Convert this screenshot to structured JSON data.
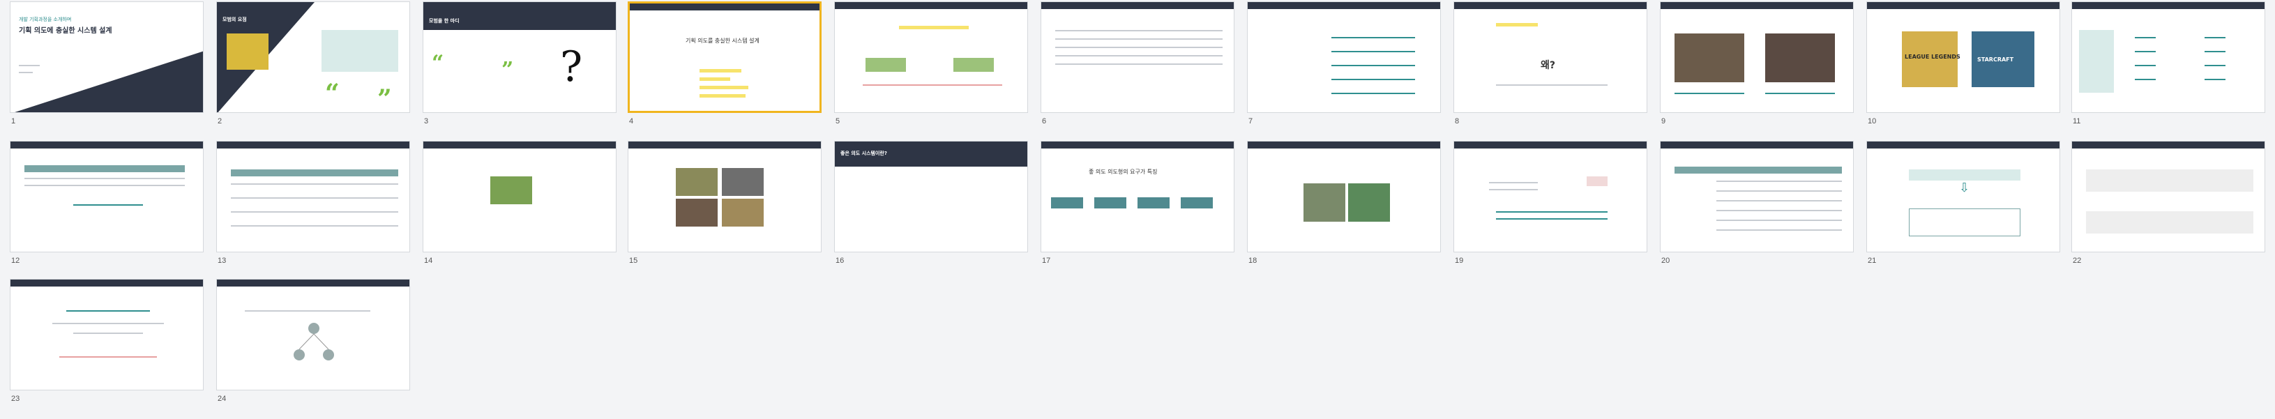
{
  "slides": [
    {
      "number": "1",
      "title_small": "개발 기획과정을 소개하며",
      "title_main": "기획 의도에 충실한 시스템 설계"
    },
    {
      "number": "2",
      "title": "모범의 요점"
    },
    {
      "number": "3",
      "title": "모범을 한 마디"
    },
    {
      "number": "4",
      "title": "기획 의도를 충실한 시스템 설계"
    },
    {
      "number": "5"
    },
    {
      "number": "6"
    },
    {
      "number": "7"
    },
    {
      "number": "8",
      "mark": "왜?"
    },
    {
      "number": "9"
    },
    {
      "number": "10",
      "game_logo_left": "LEAGUE LEGENDS",
      "game_logo_right": "STARCRAFT"
    },
    {
      "number": "11"
    },
    {
      "number": "12"
    },
    {
      "number": "13"
    },
    {
      "number": "14"
    },
    {
      "number": "15"
    },
    {
      "number": "16",
      "title": "좋은 의도 시스템이란?"
    },
    {
      "number": "17",
      "title": "좋 의도 의도형의 요구가 특징"
    },
    {
      "number": "18"
    },
    {
      "number": "19"
    },
    {
      "number": "20"
    },
    {
      "number": "21"
    },
    {
      "number": "22"
    },
    {
      "number": "23"
    },
    {
      "number": "24"
    }
  ],
  "selected_slide": "4",
  "colors": {
    "accent": "#f0b51f",
    "dark": "#2e3545",
    "teal": "#2f8f8f",
    "green": "#7bbf43"
  }
}
